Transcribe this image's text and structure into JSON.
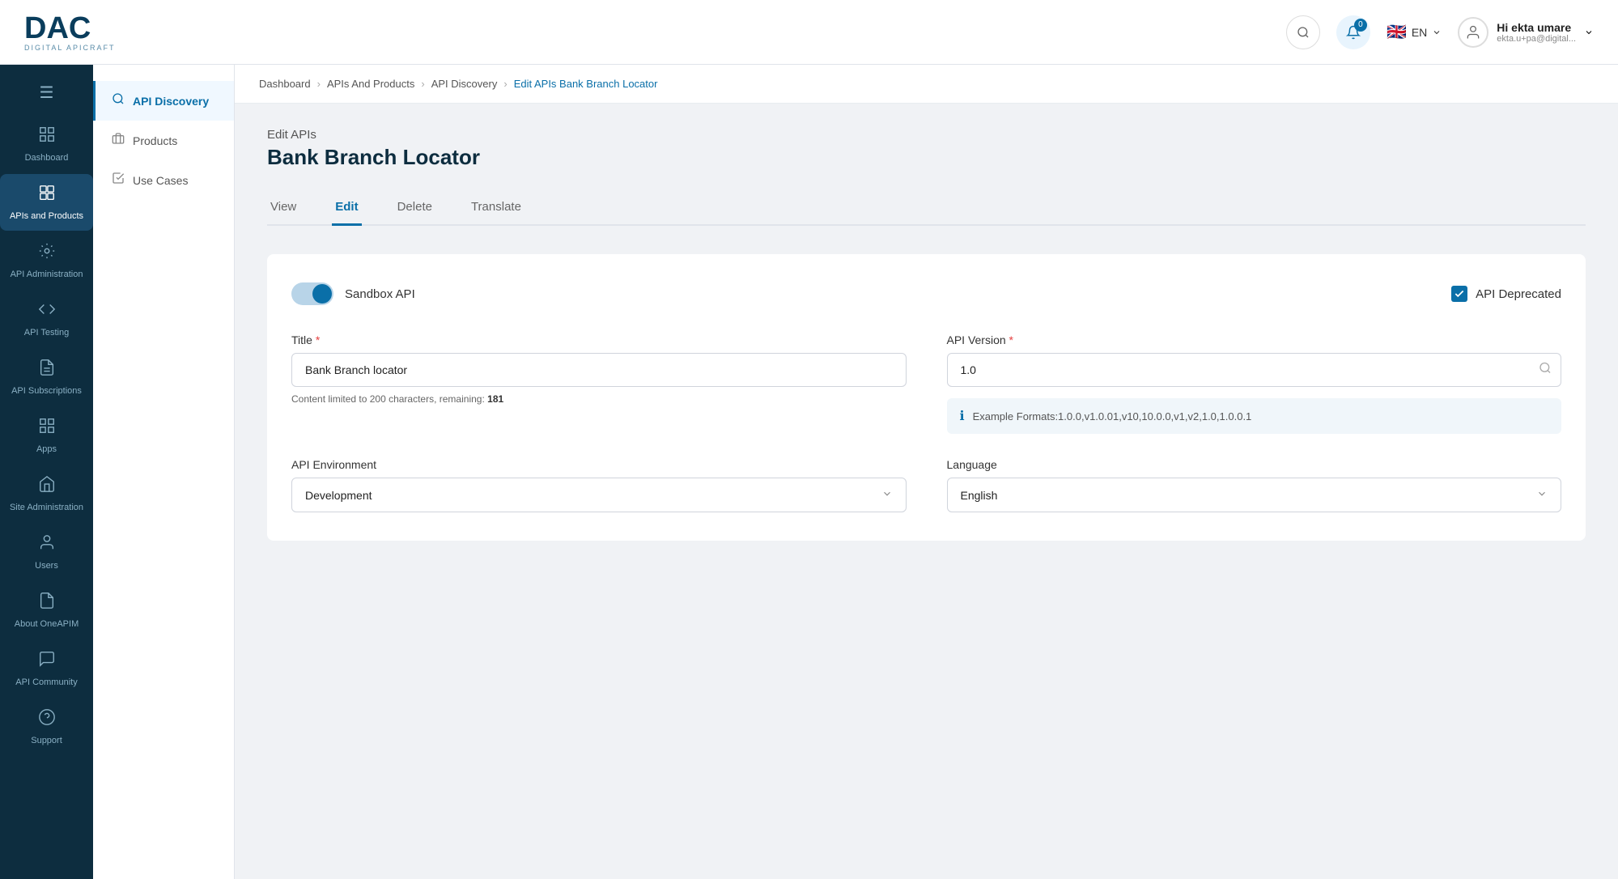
{
  "header": {
    "logo_main": "DAC",
    "logo_sub1": "DIGITAL APICRAFT",
    "lang_code": "EN",
    "notif_badge": "0",
    "user_name": "Hi ekta umare",
    "user_email": "ekta.u+pa@digital..."
  },
  "sidebar": {
    "items": [
      {
        "id": "menu",
        "label": "",
        "icon": "☰"
      },
      {
        "id": "dashboard",
        "label": "Dashboard",
        "icon": "⊞"
      },
      {
        "id": "apis-products",
        "label": "APIs and Products",
        "icon": "⧉",
        "active": true
      },
      {
        "id": "api-admin",
        "label": "API Administration",
        "icon": "⚙"
      },
      {
        "id": "api-testing",
        "label": "API Testing",
        "icon": "▦"
      },
      {
        "id": "api-subscriptions",
        "label": "API Subscriptions",
        "icon": "📋"
      },
      {
        "id": "apps",
        "label": "Apps",
        "icon": "⊡"
      },
      {
        "id": "site-admin",
        "label": "Site Administration",
        "icon": "🏢"
      },
      {
        "id": "users",
        "label": "Users",
        "icon": "👤"
      },
      {
        "id": "about",
        "label": "About OneAPIM",
        "icon": "📄"
      },
      {
        "id": "community",
        "label": "API Community",
        "icon": "💬"
      },
      {
        "id": "support",
        "label": "Support",
        "icon": "🛠"
      }
    ]
  },
  "left_panel": {
    "items": [
      {
        "id": "api-discovery",
        "label": "API Discovery",
        "active": true
      },
      {
        "id": "products",
        "label": "Products",
        "active": false
      },
      {
        "id": "use-cases",
        "label": "Use Cases",
        "active": false
      }
    ]
  },
  "breadcrumb": {
    "items": [
      {
        "label": "Dashboard",
        "active": false
      },
      {
        "label": "APIs And Products",
        "active": false
      },
      {
        "label": "API Discovery",
        "active": false
      },
      {
        "label": "Edit APIs Bank Branch Locator",
        "active": true
      }
    ]
  },
  "page": {
    "subtitle": "Edit APIs",
    "title": "Bank Branch Locator"
  },
  "tabs": [
    {
      "label": "View",
      "active": false
    },
    {
      "label": "Edit",
      "active": true
    },
    {
      "label": "Delete",
      "active": false
    },
    {
      "label": "Translate",
      "active": false
    }
  ],
  "form": {
    "sandbox_label": "Sandbox API",
    "sandbox_on": true,
    "api_deprecated_label": "API Deprecated",
    "api_deprecated_checked": true,
    "title_label": "Title",
    "title_required": true,
    "title_value": "Bank Branch locator",
    "title_char_msg": "Content limited to 200 characters, remaining:",
    "title_remaining": "181",
    "api_version_label": "API Version",
    "api_version_required": true,
    "api_version_value": "1.0",
    "api_version_example_label": "Example Formats:1.0.0,v1.0.01,v10,10.0.0,v1,v2,1.0,1.0.0.1",
    "api_env_label": "API Environment",
    "api_env_value": "Development",
    "language_label": "Language",
    "language_value": "English"
  }
}
